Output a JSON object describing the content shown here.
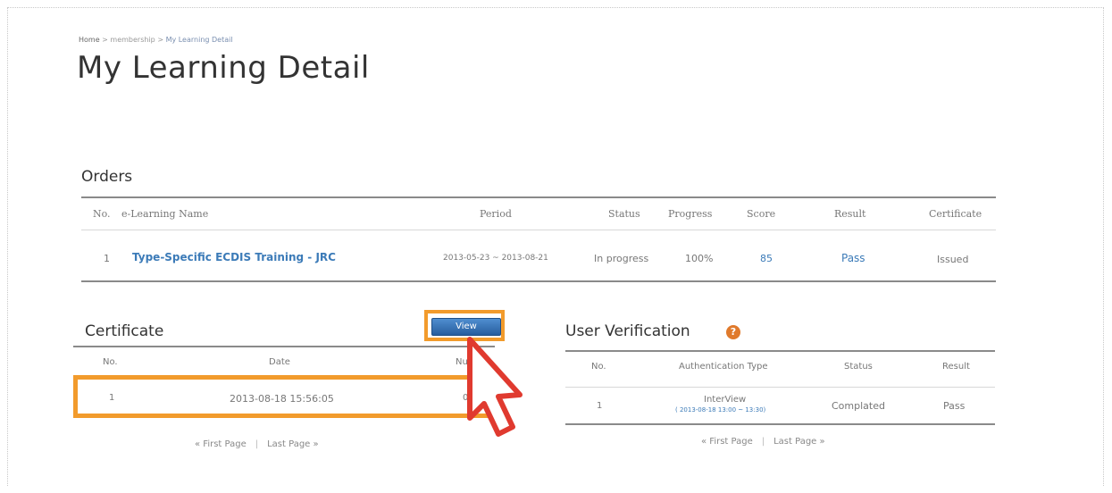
{
  "breadcrumb": {
    "home": "Home",
    "sep1": ">",
    "section": "membership",
    "sep2": ">",
    "current": "My Learning Detail"
  },
  "page_title": "My Learning Detail",
  "orders": {
    "title": "Orders",
    "columns": [
      "No.",
      "e-Learning Name",
      "Period",
      "Status",
      "Progress",
      "Score",
      "Result",
      "Certificate"
    ],
    "rows": [
      {
        "no": "1",
        "name": "Type-Specific ECDIS Training - JRC",
        "period": "2013-05-23 ~ 2013-08-21",
        "status": "In progress",
        "progress": "100%",
        "score": "85",
        "result": "Pass",
        "certificate": "Issued"
      }
    ]
  },
  "certificate": {
    "title": "Certificate",
    "view_label": "View",
    "columns": [
      "No.",
      "Date",
      "Nu"
    ],
    "rows": [
      {
        "no": "1",
        "date": "2013-08-18 15:56:05",
        "num": "0"
      }
    ],
    "pager": {
      "first": "« First Page",
      "sep": "|",
      "last": "Last Page »"
    }
  },
  "verification": {
    "title": "User Verification",
    "help_icon": "question-circle-icon",
    "columns": [
      "No.",
      "Authentication Type",
      "Status",
      "Result"
    ],
    "rows": [
      {
        "no": "1",
        "type": "InterView",
        "type_detail": "( 2013-08-18 13:00 ~ 13:30)",
        "status": "Complated",
        "result": "Pass"
      }
    ],
    "pager": {
      "first": "« First Page",
      "sep": "|",
      "last": "Last Page »"
    }
  },
  "colors": {
    "highlight": "#f29b2c",
    "link": "#3c7bb8",
    "button": "#2f6aab",
    "cursor": "#e03a2f"
  }
}
